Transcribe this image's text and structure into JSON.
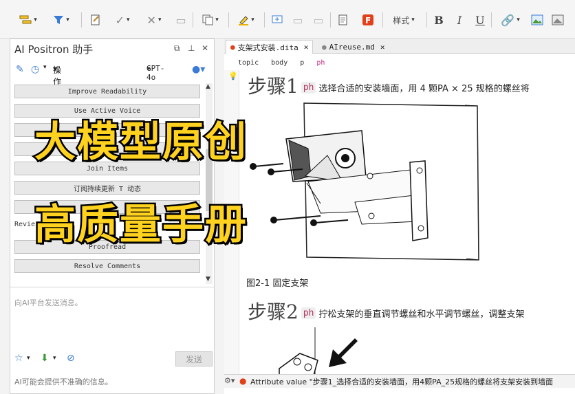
{
  "toolbar": {
    "style_label": "样式",
    "bold": "B",
    "italic": "I",
    "underline": "U"
  },
  "panel": {
    "title": "AI Positron 助手",
    "actions_label": "操作",
    "model": "GPT-4o",
    "buttons": [
      "Improve Readability",
      "Use Active Voice",
      "",
      "",
      "Join Items",
      "订阅持续更新 T 动态",
      ""
    ],
    "review_section": "Revie",
    "review_buttons": [
      "Proofread",
      "Resolve Comments"
    ],
    "input_placeholder": "向AI平台发送消息。",
    "send_label": "发送",
    "disclaimer": "AI可能会提供不准确的信息。"
  },
  "editor": {
    "tabs": [
      {
        "label": "支架式安装.dita",
        "active": true,
        "modified": true
      },
      {
        "label": "AIreuse.md",
        "active": false,
        "modified": false
      }
    ],
    "breadcrumb": [
      "topic",
      "body",
      "p",
      "ph"
    ],
    "step1_title": "步骤1",
    "step1_tag": "ph",
    "step1_text": "选择合适的安装墙面，用 4 颗PA × 25 规格的螺丝将",
    "figure_caption": "图2-1 固定支架",
    "step2_title": "步骤2",
    "step2_tag": "ph",
    "step2_text": "拧松支架的垂直调节螺丝和水平调节螺丝，调整支架"
  },
  "status": {
    "message": "Attribute value \"步骤1_选择合适的安装墙面，用4颗PA_25规格的螺丝将支架安装到墙面"
  },
  "overlay": {
    "line1": "大模型原创",
    "line2": "高质量手册"
  },
  "colors": {
    "overlay_fill": "#ffd21f",
    "ph_tag": "#b03060",
    "error": "#e0401a",
    "modified_dot": "#e0401a"
  }
}
